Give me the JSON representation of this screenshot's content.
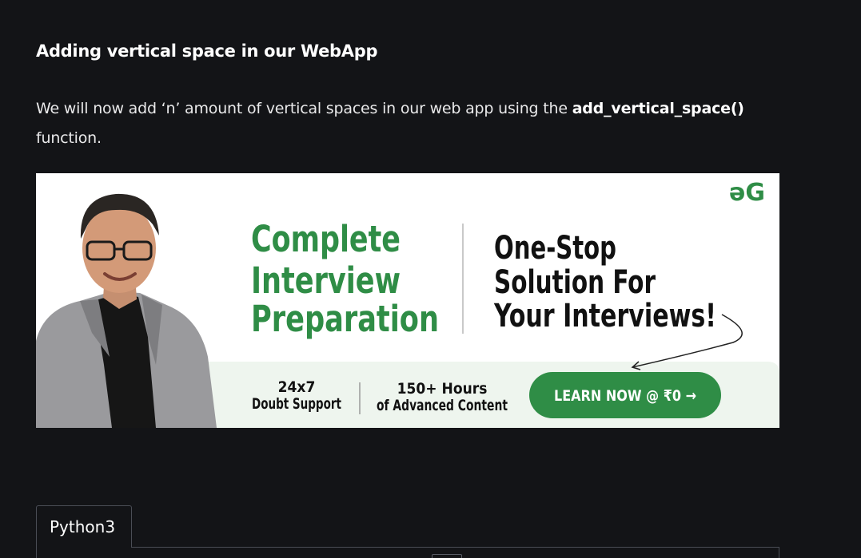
{
  "article": {
    "heading": "Adding vertical space in our WebApp",
    "para_before": "We will now add ‘n’ amount of vertical spaces in our web app using the ",
    "para_code": "add_vertical_space()",
    "para_after": " function."
  },
  "banner": {
    "logo": "əG",
    "title_lines": [
      "Complete",
      "Interview",
      "Preparation"
    ],
    "tagline_lines": [
      "One-Stop",
      "Solution For",
      "Your Interviews!"
    ],
    "feature1_lines": [
      "24x7",
      "Doubt Support"
    ],
    "feature2_lines": [
      "150+ Hours",
      "of Advanced Content"
    ],
    "cta_label": "LEARN NOW @ ₹0 →",
    "brand_green": "#2f8d46",
    "pale_green": "#eef5ee"
  },
  "code_tabs": {
    "active_tab": "Python3"
  }
}
